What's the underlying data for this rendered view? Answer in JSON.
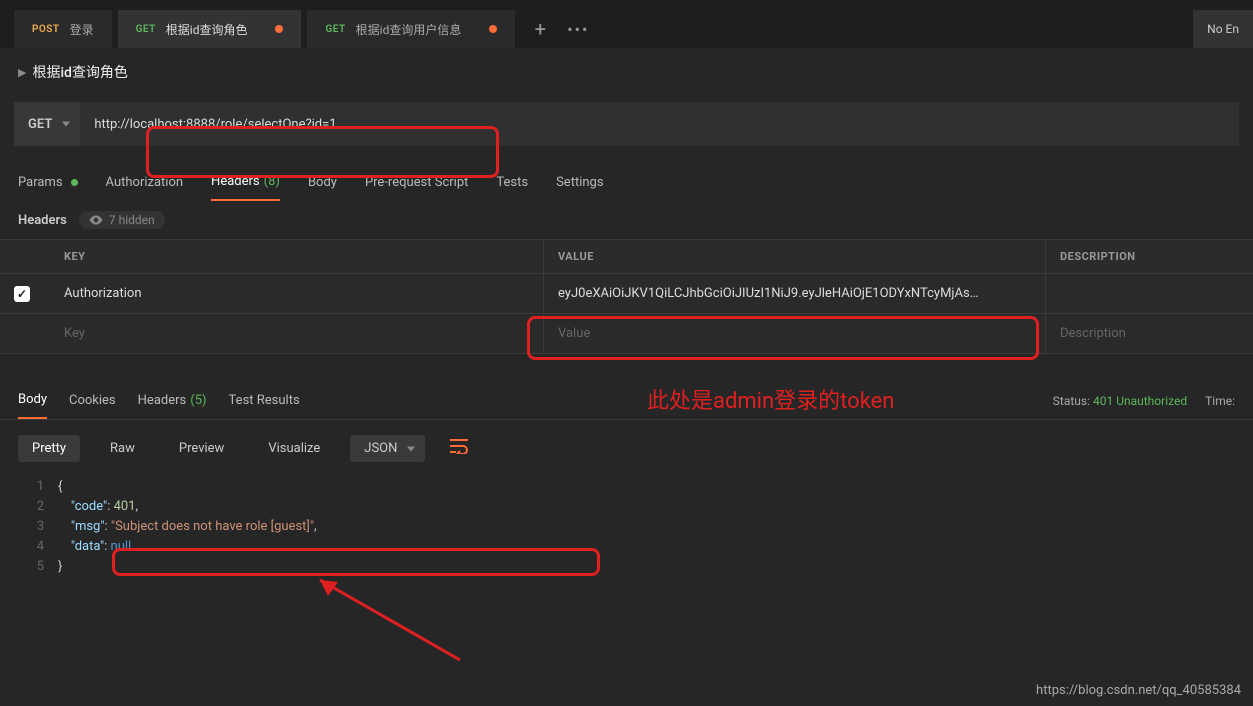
{
  "tabs": [
    {
      "method": "POST",
      "label": "登录",
      "active": false,
      "dirty": false
    },
    {
      "method": "GET",
      "label": "根据id查询角色",
      "active": true,
      "dirty": true
    },
    {
      "method": "GET",
      "label": "根据id查询用户信息",
      "active": false,
      "dirty": true
    }
  ],
  "noEnv": "No En",
  "breadcrumb": "根据id查询角色",
  "request": {
    "method": "GET",
    "url": "http://localhost:8888/role/selectOne?id=1"
  },
  "reqTabs": {
    "params": "Params",
    "authorization": "Authorization",
    "headers": "Headers",
    "headersCount": "(8)",
    "body": "Body",
    "prerequest": "Pre-request Script",
    "tests": "Tests",
    "settings": "Settings"
  },
  "headersSub": {
    "label": "Headers",
    "hidden": "7 hidden"
  },
  "headersTable": {
    "thKey": "KEY",
    "thValue": "VALUE",
    "thDesc": "DESCRIPTION",
    "rows": [
      {
        "checked": true,
        "key": "Authorization",
        "value": "eyJ0eXAiOiJKV1QiLCJhbGciOiJIUzI1NiJ9.eyJleHAiOjE1ODYxNTcyMjAs…"
      }
    ],
    "placeholderKey": "Key",
    "placeholderValue": "Value",
    "placeholderDesc": "Description"
  },
  "annotation": "此处是admin登录的token",
  "respTabs": {
    "body": "Body",
    "cookies": "Cookies",
    "headers": "Headers",
    "headersCount": "(5)",
    "testResults": "Test Results"
  },
  "respMeta": {
    "statusLabel": "Status:",
    "status": "401 Unauthorized",
    "timeLabel": "Time:"
  },
  "respToolbar": {
    "pretty": "Pretty",
    "raw": "Raw",
    "preview": "Preview",
    "visualize": "Visualize",
    "format": "JSON"
  },
  "responseBody": {
    "code": 401,
    "msg": "Subject does not have role [guest]",
    "data": null
  },
  "watermark": "https://blog.csdn.net/qq_40585384"
}
